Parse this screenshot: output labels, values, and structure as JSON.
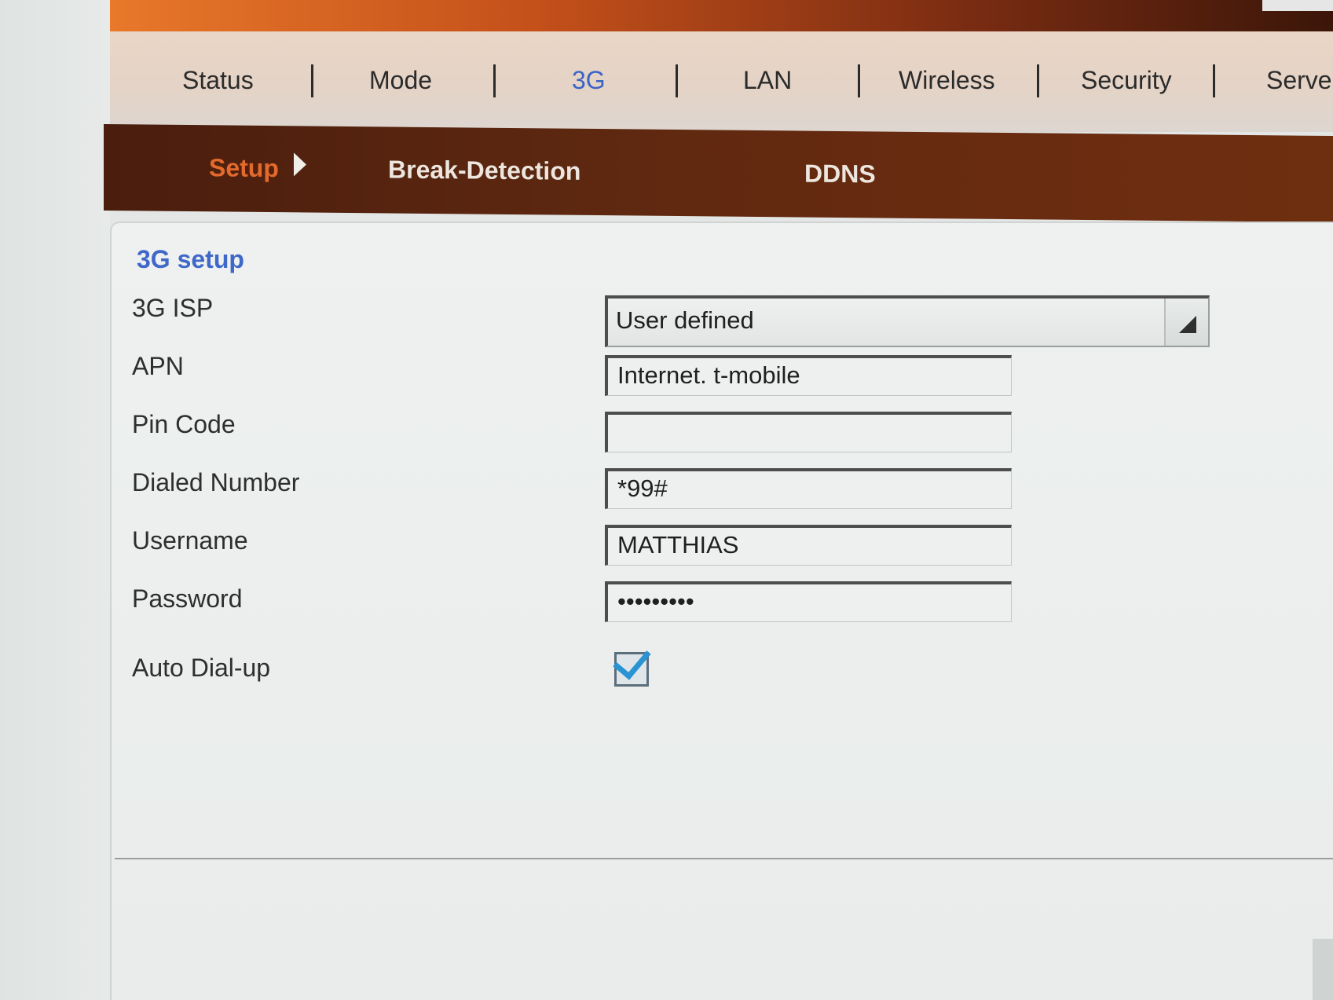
{
  "top_nav": {
    "items": [
      {
        "label": "Status"
      },
      {
        "label": "Mode"
      },
      {
        "label": "3G"
      },
      {
        "label": "LAN"
      },
      {
        "label": "Wireless"
      },
      {
        "label": "Security"
      },
      {
        "label": "Server"
      }
    ],
    "active": "3G"
  },
  "sub_nav": {
    "items": [
      {
        "label": "Setup"
      },
      {
        "label": "Break-Detection"
      },
      {
        "label": "DDNS"
      }
    ],
    "active": "Setup"
  },
  "section": {
    "title": "3G setup"
  },
  "form": {
    "isp": {
      "label": "3G ISP",
      "value": "User defined"
    },
    "apn": {
      "label": "APN",
      "value": "Internet. t-mobile"
    },
    "pin": {
      "label": "Pin Code",
      "value": ""
    },
    "dialed_number": {
      "label": "Dialed Number",
      "value": "*99#"
    },
    "username": {
      "label": "Username",
      "value": "MATTHIAS"
    },
    "password": {
      "label": "Password",
      "value": "•••••••••"
    },
    "auto_dialup": {
      "label": "Auto Dial-up",
      "checked": true
    }
  },
  "colors": {
    "active_nav": "#3a63c6",
    "active_subnav": "#e36a2c",
    "subnav_bg": "#5e2810",
    "banner": "#c4501a",
    "checkbox_check": "#2a93d3"
  }
}
